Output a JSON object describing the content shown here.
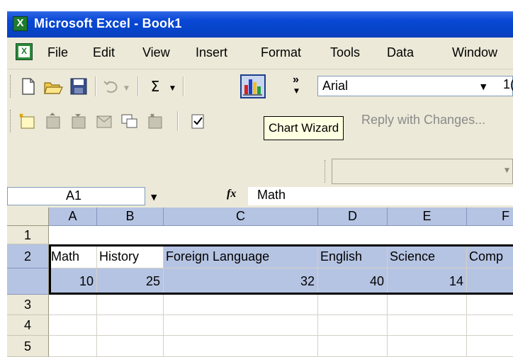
{
  "window": {
    "title": "Microsoft Excel - Book1"
  },
  "menu": {
    "items": [
      {
        "label": "File",
        "name": "menu-file"
      },
      {
        "label": "Edit",
        "name": "menu-edit"
      },
      {
        "label": "View",
        "name": "menu-view"
      },
      {
        "label": "Insert",
        "name": "menu-insert"
      },
      {
        "label": "Format",
        "name": "menu-format"
      },
      {
        "label": "Tools",
        "name": "menu-tools"
      },
      {
        "label": "Data",
        "name": "menu-data"
      },
      {
        "label": "Window",
        "name": "menu-window"
      }
    ]
  },
  "toolbar": {
    "sum_symbol": "Σ",
    "more_symbol": "»",
    "font_name": "Arial",
    "font_size_partial": "1(",
    "reply_text": "Reply with Changes...",
    "tooltip": "Chart Wizard"
  },
  "formula_bar": {
    "cell_ref": "A1",
    "fx_label": "fx",
    "formula": "Math"
  },
  "sheet": {
    "columns": [
      "A",
      "B",
      "C",
      "D",
      "E",
      "F"
    ],
    "rows": [
      "1",
      "2",
      "3",
      "4",
      "5"
    ],
    "row1": [
      "Math",
      "History",
      "Foreign Language",
      "English",
      "Science",
      "Comp"
    ],
    "row2": [
      "10",
      "25",
      "32",
      "40",
      "14",
      ""
    ]
  },
  "colors": {
    "title_bar": "#0a47d5",
    "selection": "#b6c4e3",
    "chrome": "#ece9d8"
  }
}
